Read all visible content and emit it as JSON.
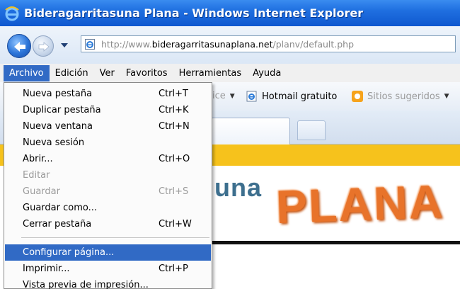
{
  "window": {
    "title": "Bideragarritasuna Plana - Windows Internet Explorer"
  },
  "address_bar": {
    "url_prefix": "http://www.",
    "url_domain": "bideragarritasunaplana.net",
    "url_path": "/planv/default.php"
  },
  "menubar": {
    "items": [
      "Archivo",
      "Edición",
      "Ver",
      "Favoritos",
      "Herramientas",
      "Ayuda"
    ],
    "active": "Archivo"
  },
  "favorites": {
    "partial_item": "ice",
    "hotmail": "Hotmail gratuito",
    "sitios": "Sitios sugeridos"
  },
  "file_menu": {
    "items": [
      {
        "label": "Nueva pestaña",
        "shortcut": "Ctrl+T",
        "enabled": true
      },
      {
        "label": "Duplicar pestaña",
        "shortcut": "Ctrl+K",
        "enabled": true
      },
      {
        "label": "Nueva ventana",
        "shortcut": "Ctrl+N",
        "enabled": true
      },
      {
        "label": "Nueva sesión",
        "shortcut": "",
        "enabled": true
      },
      {
        "label": "Abrir...",
        "shortcut": "Ctrl+O",
        "enabled": true
      },
      {
        "label": "Editar",
        "shortcut": "",
        "enabled": false
      },
      {
        "label": "Guardar",
        "shortcut": "Ctrl+S",
        "enabled": false
      },
      {
        "label": "Guardar como...",
        "shortcut": "",
        "enabled": true
      },
      {
        "label": "Cerrar pestaña",
        "shortcut": "Ctrl+W",
        "enabled": true
      },
      {
        "label": "Configurar página...",
        "shortcut": "",
        "enabled": true,
        "highlighted": true
      },
      {
        "label": "Imprimir...",
        "shortcut": "Ctrl+P",
        "enabled": true
      },
      {
        "label": "Vista previa de impresión...",
        "shortcut": "",
        "enabled": true
      }
    ]
  },
  "page": {
    "logo_part1": "una",
    "logo_part2": "PLANA"
  },
  "colors": {
    "title_bar": "#1f6fe0",
    "menu_highlight": "#316ac5",
    "page_band": "#f6c21c",
    "logo_orange": "#e8732a",
    "logo_blue": "#3d6f8e"
  }
}
